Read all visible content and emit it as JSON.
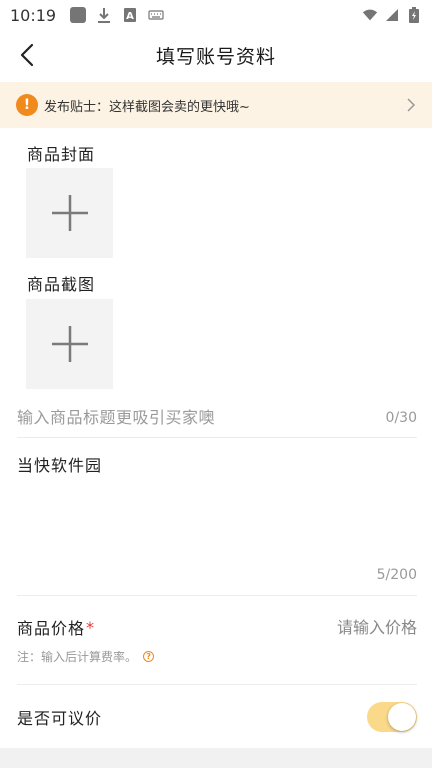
{
  "status_bar": {
    "time": "10:19",
    "icons_left": [
      "notification-square-icon",
      "download-icon",
      "a-icon",
      "keyboard-icon"
    ],
    "icons_right": [
      "wifi-icon",
      "signal-icon",
      "battery-charging-icon"
    ]
  },
  "header": {
    "title": "填写账号资料"
  },
  "tip": {
    "icon_text": "!",
    "text": "发布贴士：这样截图会卖的更快哦~"
  },
  "cover": {
    "label": "商品封面"
  },
  "screenshots": {
    "label": "商品截图"
  },
  "title_field": {
    "placeholder": "输入商品标题更吸引买家噢",
    "counter": "0/30"
  },
  "description": {
    "value": "当快软件园",
    "counter": "5/200"
  },
  "price": {
    "label": "商品价格",
    "required_mark": "*",
    "placeholder": "请输入价格",
    "note": "注：输入后计算费率。",
    "help_icon_text": "?"
  },
  "negotiable": {
    "label": "是否可议价",
    "enabled": true
  },
  "colors": {
    "accent": "#f08a1c",
    "tip_bg": "#fdf3e4",
    "toggle_on": "#fbd98a",
    "required": "#e53935"
  }
}
